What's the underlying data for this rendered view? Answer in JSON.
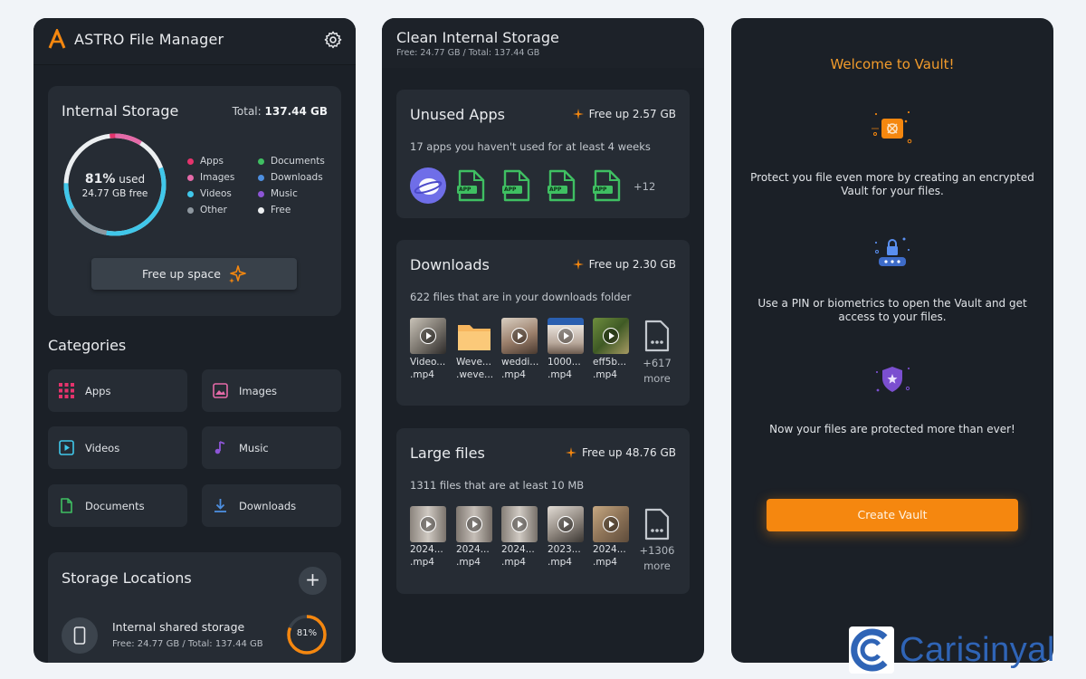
{
  "phone1": {
    "app_title": "ASTRO File Manager",
    "storage": {
      "title": "Internal Storage",
      "total_label": "Total:",
      "total_value": "137.44 GB",
      "used_pct": "81%",
      "used_word": "used",
      "free_text": "24.77 GB free",
      "legend": [
        {
          "label": "Apps",
          "color": "#e5336c"
        },
        {
          "label": "Documents",
          "color": "#3fbf62"
        },
        {
          "label": "Images",
          "color": "#e56aa8"
        },
        {
          "label": "Downloads",
          "color": "#4d8fe0"
        },
        {
          "label": "Videos",
          "color": "#40c7ea"
        },
        {
          "label": "Music",
          "color": "#8d55d6"
        },
        {
          "label": "Other",
          "color": "#8e979f"
        },
        {
          "label": "Free",
          "color": "#eceff1"
        }
      ],
      "free_up_label": "Free up space"
    },
    "categories_title": "Categories",
    "categories": [
      {
        "label": "Apps",
        "icon": "apps-grid-icon",
        "color": "#e5336c"
      },
      {
        "label": "Images",
        "icon": "image-icon",
        "color": "#e56aa8"
      },
      {
        "label": "Videos",
        "icon": "video-icon",
        "color": "#40c7ea"
      },
      {
        "label": "Music",
        "icon": "music-icon",
        "color": "#8d55d6"
      },
      {
        "label": "Documents",
        "icon": "document-icon",
        "color": "#3fbf62"
      },
      {
        "label": "Downloads",
        "icon": "download-icon",
        "color": "#4d8fe0"
      }
    ],
    "locations": {
      "title": "Storage Locations",
      "add_symbol": "+",
      "item_name": "Internal shared storage",
      "item_sub": "Free: 24.77 GB / Total: 137.44 GB",
      "item_pct": "81%",
      "item_fraction": 0.81
    }
  },
  "phone2": {
    "title": "Clean Internal Storage",
    "subtitle": "Free: 24.77 GB / Total: 137.44 GB",
    "unused": {
      "title": "Unused Apps",
      "free_up": "Free up 2.57 GB",
      "desc": "17 apps you haven't used for at least 4 weeks",
      "app_badge": "APP",
      "more": "+12"
    },
    "downloads": {
      "title": "Downloads",
      "free_up": "Free up 2.30 GB",
      "desc": "622 files that are in your downloads folder",
      "files": [
        {
          "name": "Video...",
          "ext": ".mp4"
        },
        {
          "name": "Weve...",
          "ext": ".weve..."
        },
        {
          "name": "weddi...",
          "ext": ".mp4"
        },
        {
          "name": "1000...",
          "ext": ".mp4"
        },
        {
          "name": "eff5b...",
          "ext": ".mp4"
        }
      ],
      "more_count": "+617",
      "more_word": "more"
    },
    "large": {
      "title": "Large files",
      "free_up": "Free up 48.76 GB",
      "desc": "1311 files that are at least 10 MB",
      "files": [
        {
          "name": "2024...",
          "ext": ".mp4"
        },
        {
          "name": "2024...",
          "ext": ".mp4"
        },
        {
          "name": "2024...",
          "ext": ".mp4"
        },
        {
          "name": "2023...",
          "ext": ".mp4"
        },
        {
          "name": "2024...",
          "ext": ".mp4"
        }
      ],
      "more_count": "+1306",
      "more_word": "more"
    }
  },
  "phone3": {
    "title": "Welcome to Vault!",
    "text1": "Protect you file even more by creating an encrypted Vault for your files.",
    "text2": "Use a PIN or biometrics to open the Vault and get access to your files.",
    "text3": "Now your files are protected more than ever!",
    "button": "Create Vault"
  },
  "watermark": "Carisinyal",
  "colors": {
    "accent": "#f5870f",
    "background": "#1b2027",
    "card": "#262c34"
  }
}
